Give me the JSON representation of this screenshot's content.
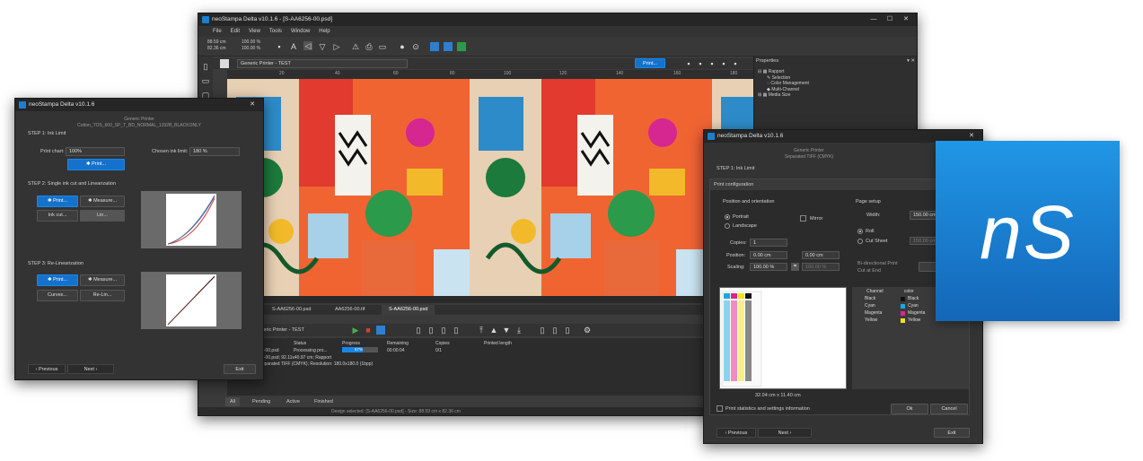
{
  "main": {
    "title": "neoStampa Delta v10.1.6 - [S-AA6256-00.psd]",
    "menu": [
      "File",
      "Edit",
      "View",
      "Tools",
      "Window",
      "Help"
    ],
    "coords": [
      "88.59 cm",
      "82.36 cm",
      "100.00 %",
      "100.00 %"
    ],
    "printer_select": "Generic Printer - TEST",
    "print_button": "Print...",
    "ruler": [
      "20",
      "40",
      "60",
      "80",
      "100",
      "120",
      "140",
      "160",
      "180"
    ],
    "properties": {
      "title": "Properties",
      "tree": [
        "Rapport",
        "Selection",
        "Color Management",
        "Multi-Channel",
        "Media Size"
      ]
    },
    "tabs": [
      "S-AA6256-00.psd",
      "AA6256-00.tif",
      "S-AA6256-00.psd"
    ],
    "queue": {
      "printer": "Generic Printer - TEST",
      "headers": [
        "Status",
        "Progress",
        "Remaining",
        "Copies",
        "Printed length"
      ],
      "row": {
        "name": "S-AA6256-00.psd",
        "status": "Processing pro...",
        "progress": "57%",
        "remaining": "00:00:04",
        "copies": "0/1"
      },
      "info1": "S-AA6256-00.psd; 92.11x40.97 cm; Rapport",
      "info2": "Printer: Separated TIFF (CMYK); Resolution: 180.0x180.0 (1bpp)",
      "filters": [
        "All",
        "Pending",
        "Active",
        "Finished"
      ],
      "progress": 0.57
    },
    "status": "Design selected: [S-AA6256-00.psd] - Size: 88.59 cm x 82.36 cm"
  },
  "left": {
    "title": "neoStampa Delta v10.1.6",
    "header1": "Generic Printer",
    "header2": "Cotton_TOS_600_SP_T_BD_NORMAL_1332B_BLACKONLY",
    "step1": "STEP 1: Ink Limit",
    "print_chart_label": "Print chart:",
    "print_chart_value": "100%",
    "chosen_ink_label": "Chosen ink limit:",
    "chosen_ink_value": "180 %",
    "print_btn": "Print...",
    "step2": "STEP 2: Single ink cut and Linearization",
    "measure_btn": "Measure...",
    "inkcut_btn": "Ink cut...",
    "lin_btn": "Lin...",
    "step3": "STEP 3: Re-Linearization",
    "curves_btn": "Curves...",
    "relin_btn": "Re-Lin...",
    "prev_btn": "Previous",
    "next_btn": "Next",
    "exit_btn": "Exit"
  },
  "right": {
    "title": "neoStampa Delta v10.1.6",
    "header1": "Generic Printer",
    "header2": "Separated TIFF (CMYK)",
    "step1": "STEP 1: Ink Limit",
    "config_title": "Print configuration",
    "position_title": "Position and orientation",
    "portrait": "Portrait",
    "landscape": "Landscape",
    "mirror": "Mirror",
    "copies_label": "Copies:",
    "copies_value": "1",
    "position_label": "Position:",
    "pos_x": "0.00 cm",
    "pos_y": "0.00 cm",
    "scaling_label": "Scaling:",
    "scale_x": "100.00 %",
    "scale_y": "100.00 %",
    "page_title": "Page setup",
    "width_label": "Width:",
    "width_value": "150.00 cm",
    "roll": "Roll",
    "cutsheet": "Cut Sheet",
    "cutsheet_value": "150.00 cm",
    "bidir": "Bi-directional Print",
    "cutend": "Cut at End",
    "adv_btn": "Adv",
    "channel_header": "Channel",
    "color_header": "color",
    "channels": [
      {
        "name": "Black",
        "color": "Black",
        "hex": "#111111"
      },
      {
        "name": "Cyan",
        "color": "Cyan",
        "hex": "#19a9e0"
      },
      {
        "name": "Magenta",
        "color": "Magenta",
        "hex": "#d6268f"
      },
      {
        "name": "Yellow",
        "color": "Yellow",
        "hex": "#f1e21c"
      }
    ],
    "size": "32.04 cm x 11.40 cm",
    "stats": "Print statistics and settings information",
    "ok_btn": "Ok",
    "cancel_btn": "Cancel",
    "prev_btn": "Previous",
    "next_btn": "Next",
    "exit_btn": "Exit"
  },
  "logo": {
    "text": "nS",
    "color": "#1a7fd1"
  }
}
